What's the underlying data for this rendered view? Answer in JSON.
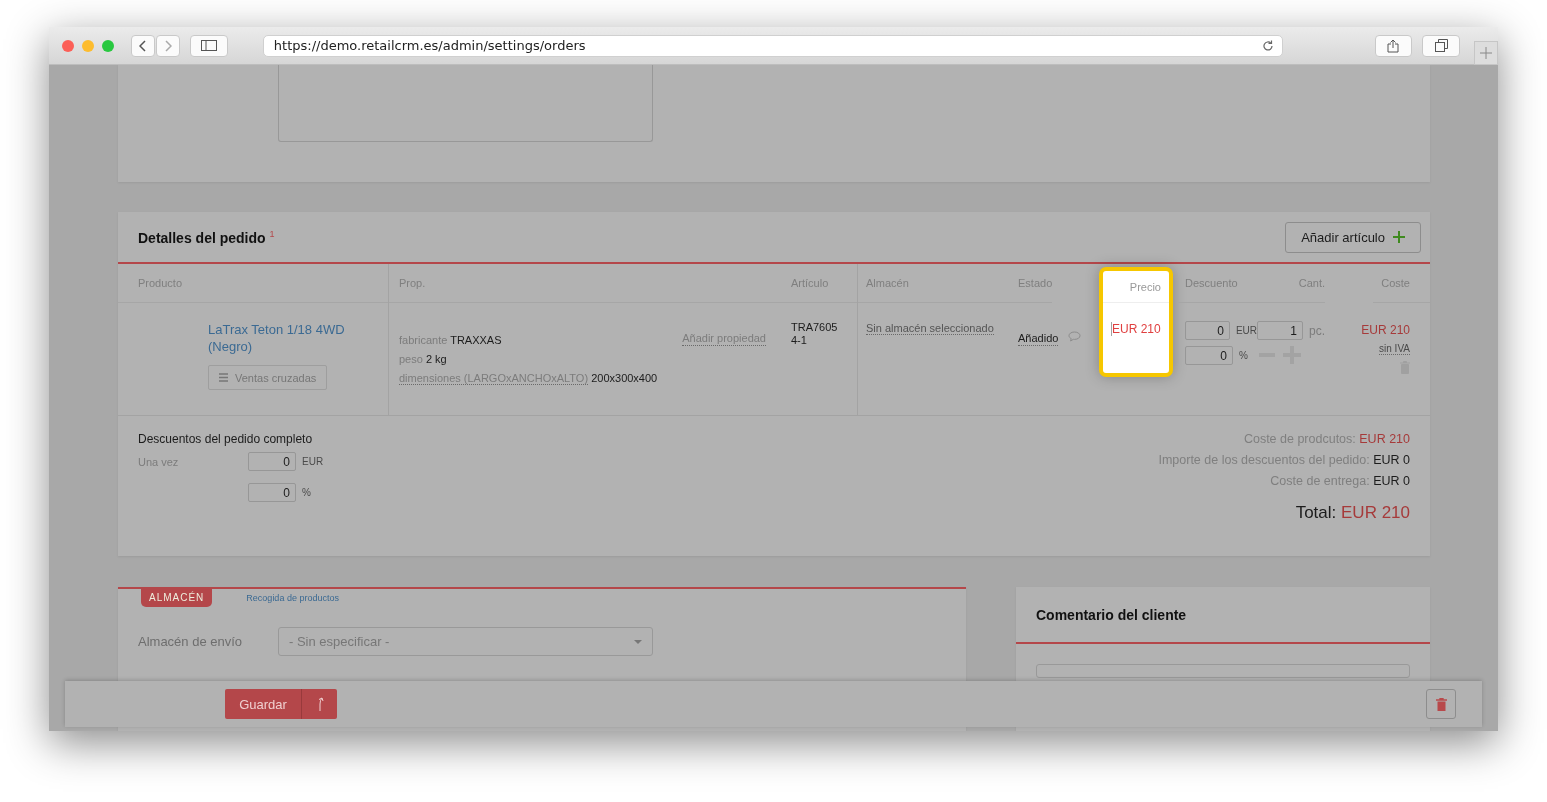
{
  "browser": {
    "url": "https://demo.retailcrm.es/admin/settings/orders"
  },
  "order_details": {
    "title": "Detalles del pedido",
    "required_mark": "1",
    "add_button": "Añadir artículo",
    "columns": [
      {
        "label": "Producto",
        "kind": "product"
      },
      {
        "label": "Prop.",
        "kind": "props"
      },
      {
        "label": "Artículo",
        "kind": "article"
      },
      {
        "label": "Almacén",
        "kind": "warehouse"
      },
      {
        "label": "Estado",
        "kind": "status"
      },
      {
        "label": "Precio",
        "kind": "price"
      },
      {
        "label": "Descuento",
        "kind": "discount"
      },
      {
        "label": "Cant.",
        "kind": "quantity"
      },
      {
        "label": "Coste",
        "kind": "cost"
      }
    ],
    "price_column_highlighted": true,
    "item": {
      "product_name": "LaTrax Teton 1/18 4WD (Negro)",
      "cross_sell": "Ventas cruzadas",
      "properties": [
        {
          "name": "fabricante",
          "value": "TRAXXAS",
          "kind": "plain"
        },
        {
          "name": "peso",
          "value": "2 kg",
          "kind": "plain"
        },
        {
          "name": "dimensiones (LARGOxANCHOxALTO)",
          "value": "200x300x400",
          "kind": "dotted"
        }
      ],
      "add_property": "Añadir propiedad",
      "article": "TRA7605 4-1",
      "warehouse": "Sin almacén seleccionado",
      "status": "Añadido",
      "price": "EUR 210",
      "discount_amount": "0",
      "discount_currency": "EUR",
      "discount_percent": "0",
      "percent_sign": "%",
      "quantity": "1",
      "unit": "pc.",
      "cost": "EUR 210",
      "vat_note": "sin IVA"
    },
    "order_discounts": {
      "title": "Descuentos del pedido completo",
      "once_label": "Una vez",
      "amount": "0",
      "currency": "EUR",
      "percent": "0",
      "percent_sign": "%"
    },
    "totals": [
      {
        "label": "Coste de prodcutos:",
        "value": "EUR 210",
        "kind": "accent"
      },
      {
        "label": "Importe de los descuentos del pedido:",
        "value": "EUR 0",
        "kind": "plain"
      },
      {
        "label": "Coste de entrega:",
        "value": "EUR 0",
        "kind": "plain"
      }
    ],
    "total": {
      "label": "Total:",
      "value": "EUR 210"
    }
  },
  "warehouse_section": {
    "tabs": [
      {
        "label": "ALMACÉN",
        "selected": true
      },
      {
        "label": "Recogida de productos",
        "selected": false
      }
    ],
    "shipping_label": "Almacén de envío",
    "shipping_value": "- Sin especificar -"
  },
  "customer_comment": {
    "title": "Comentario del cliente"
  },
  "footer": {
    "save_button": "Guardar"
  }
}
